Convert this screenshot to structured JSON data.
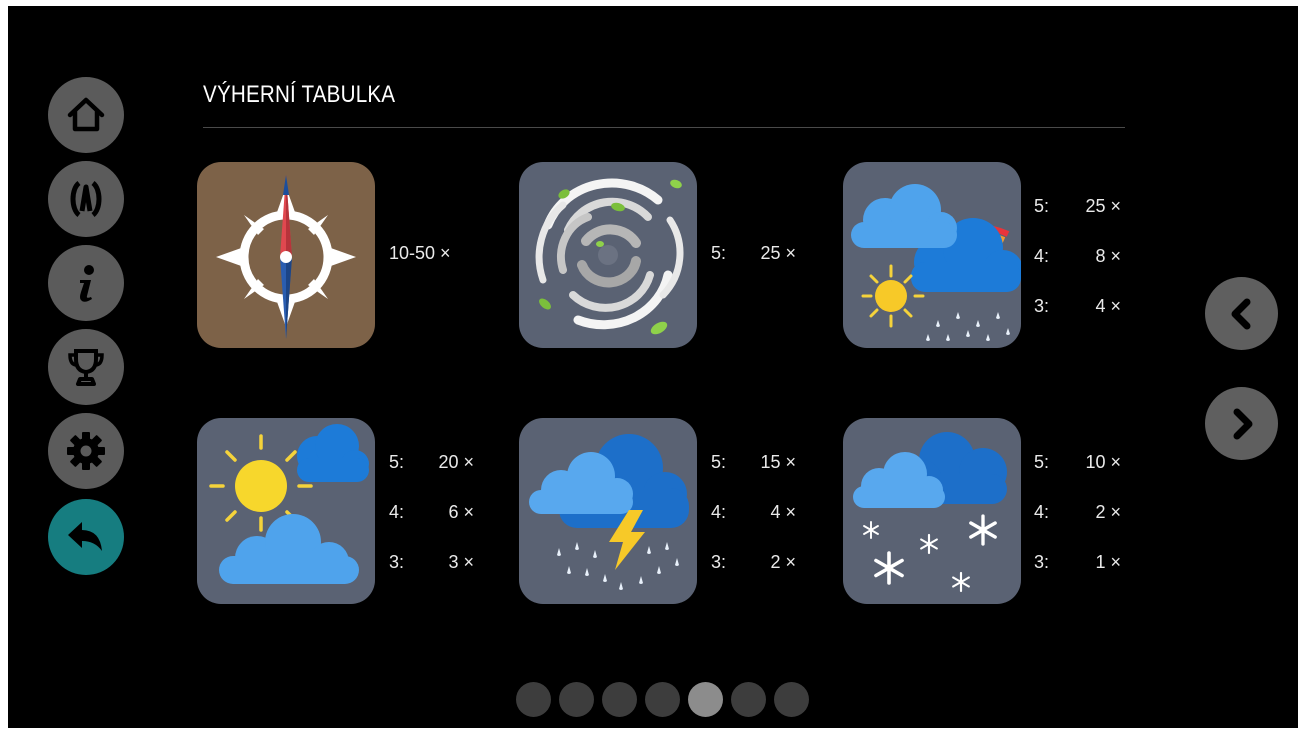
{
  "page_title": "VÝHERNÍ TABULKA",
  "sidebar": {
    "items": [
      {
        "name": "home",
        "icon": "home-icon"
      },
      {
        "name": "game",
        "icon": "game-logo-icon"
      },
      {
        "name": "info",
        "icon": "info-icon"
      },
      {
        "name": "trophy",
        "icon": "trophy-icon"
      },
      {
        "name": "settings",
        "icon": "gear-icon"
      },
      {
        "name": "back",
        "icon": "back-arrow-icon"
      }
    ],
    "accent_color": "#167d80"
  },
  "symbols": [
    {
      "id": "compass",
      "icon": "compass-icon",
      "payouts": [
        {
          "label": "10-50 ×"
        }
      ]
    },
    {
      "id": "tornado",
      "icon": "tornado-icon",
      "payouts": [
        {
          "count": "5:",
          "mult": "25 ×"
        }
      ]
    },
    {
      "id": "rainbow",
      "icon": "rainbow-cloud-icon",
      "payouts": [
        {
          "count": "5:",
          "mult": "25 ×"
        },
        {
          "count": "4:",
          "mult": "8 ×"
        },
        {
          "count": "3:",
          "mult": "4 ×"
        }
      ]
    },
    {
      "id": "sun-clouds",
      "icon": "sun-cloud-icon",
      "payouts": [
        {
          "count": "5:",
          "mult": "20 ×"
        },
        {
          "count": "4:",
          "mult": "6 ×"
        },
        {
          "count": "3:",
          "mult": "3 ×"
        }
      ]
    },
    {
      "id": "storm",
      "icon": "thunderstorm-icon",
      "payouts": [
        {
          "count": "5:",
          "mult": "15 ×"
        },
        {
          "count": "4:",
          "mult": "4 ×"
        },
        {
          "count": "3:",
          "mult": "2 ×"
        }
      ]
    },
    {
      "id": "snow",
      "icon": "snow-cloud-icon",
      "payouts": [
        {
          "count": "5:",
          "mult": "10 ×"
        },
        {
          "count": "4:",
          "mult": "2 ×"
        },
        {
          "count": "3:",
          "mult": "1 ×"
        }
      ]
    }
  ],
  "pagination": {
    "pages": 7,
    "current": 5
  },
  "nav": {
    "prev_icon": "chevron-left-icon",
    "next_icon": "chevron-right-icon"
  }
}
